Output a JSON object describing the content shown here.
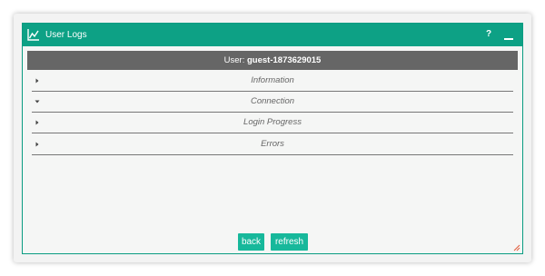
{
  "window": {
    "title": "User Logs",
    "help_label": "?",
    "accent_color": "#0da185",
    "icons": {
      "title": "chart-line-icon",
      "minimize": "minimize-icon",
      "resize": "resize-grip-icon"
    }
  },
  "user": {
    "label": "User:",
    "name": "guest-1873629015"
  },
  "sections": [
    {
      "label": "Information",
      "expanded": false
    },
    {
      "label": "Connection",
      "expanded": true
    },
    {
      "label": "Login Progress",
      "expanded": false
    },
    {
      "label": "Errors",
      "expanded": false
    }
  ],
  "buttons": {
    "back": "back",
    "refresh": "refresh"
  }
}
